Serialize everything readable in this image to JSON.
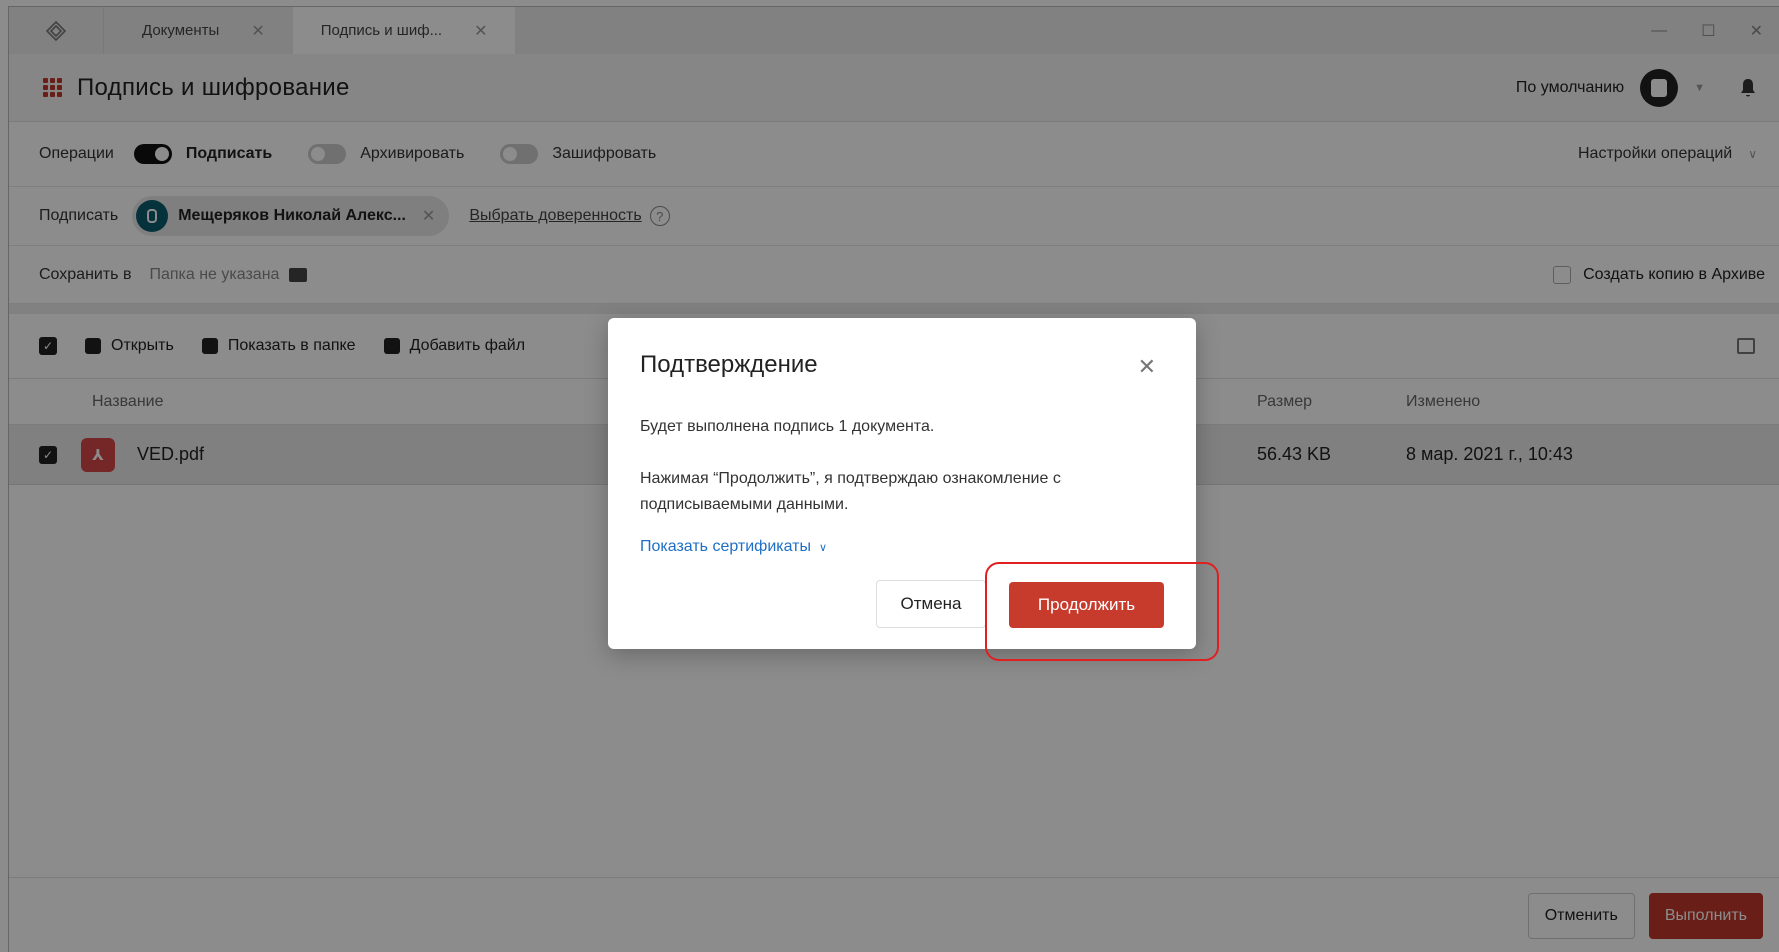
{
  "tabs": [
    {
      "label": "Документы"
    },
    {
      "label": "Подпись и шиф..."
    }
  ],
  "header": {
    "title": "Подпись и шифрование",
    "profile": "По умолчанию"
  },
  "operations": {
    "label": "Операции",
    "sign": "Подписать",
    "archive": "Архивировать",
    "encrypt": "Зашифровать",
    "settings": "Настройки операций"
  },
  "signer": {
    "label": "Подписать",
    "name": "Мещеряков Николай Алекс...",
    "proxy_link": "Выбрать доверенность",
    "help": "?"
  },
  "save": {
    "label": "Сохранить в",
    "folder": "Папка не указана",
    "copy_archive": "Создать копию в Архиве"
  },
  "toolbar": {
    "open": "Открыть",
    "show_in_folder": "Показать в папке",
    "add_file": "Добавить файл"
  },
  "table": {
    "columns": [
      "Название",
      "Размер",
      "Изменено"
    ],
    "rows": [
      {
        "name": "VED.pdf",
        "size": "56.43 KB",
        "modified": "8 мар. 2021 г., 10:43"
      }
    ]
  },
  "footer": {
    "cancel": "Отменить",
    "execute": "Выполнить"
  },
  "dialog": {
    "title": "Подтверждение",
    "line1": "Будет выполнена подпись 1 документа.",
    "line2": "Нажимая “Продолжить”, я подтверждаю ознакомление с подписываемыми данными.",
    "show_certs": "Показать сертификаты",
    "cancel": "Отмена",
    "continue": "Продолжить"
  },
  "colors": {
    "accent_red": "#c73b2c",
    "link_blue": "#1e6fc5",
    "highlight": "#e02020"
  }
}
